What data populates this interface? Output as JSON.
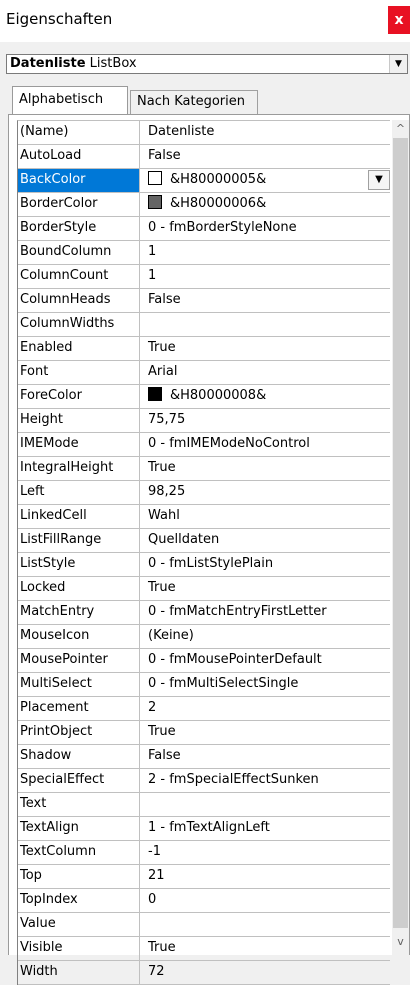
{
  "window": {
    "title": "Eigenschaften",
    "close_label": "x"
  },
  "object_selector": {
    "name": "Datenliste",
    "type": "ListBox",
    "arrow": "▼"
  },
  "tabs": [
    {
      "label": "Alphabetisch",
      "active": true
    },
    {
      "label": "Nach Kategorien",
      "active": false
    }
  ],
  "properties": [
    {
      "name": "(Name)",
      "value": "Datenliste"
    },
    {
      "name": "AutoLoad",
      "value": "False"
    },
    {
      "name": "BackColor",
      "value": "&H80000005&",
      "swatch": "#ffffff",
      "selected": true
    },
    {
      "name": "BorderColor",
      "value": "&H80000006&",
      "swatch": "#646464"
    },
    {
      "name": "BorderStyle",
      "value": "0 - fmBorderStyleNone"
    },
    {
      "name": "BoundColumn",
      "value": "1"
    },
    {
      "name": "ColumnCount",
      "value": "1"
    },
    {
      "name": "ColumnHeads",
      "value": "False"
    },
    {
      "name": "ColumnWidths",
      "value": ""
    },
    {
      "name": "Enabled",
      "value": "True"
    },
    {
      "name": "Font",
      "value": "Arial"
    },
    {
      "name": "ForeColor",
      "value": "&H80000008&",
      "swatch": "#000000"
    },
    {
      "name": "Height",
      "value": "75,75"
    },
    {
      "name": "IMEMode",
      "value": "0 - fmIMEModeNoControl"
    },
    {
      "name": "IntegralHeight",
      "value": "True"
    },
    {
      "name": "Left",
      "value": "98,25"
    },
    {
      "name": "LinkedCell",
      "value": "Wahl"
    },
    {
      "name": "ListFillRange",
      "value": "Quelldaten"
    },
    {
      "name": "ListStyle",
      "value": "0 - fmListStylePlain"
    },
    {
      "name": "Locked",
      "value": "True"
    },
    {
      "name": "MatchEntry",
      "value": "0 - fmMatchEntryFirstLetter"
    },
    {
      "name": "MouseIcon",
      "value": "(Keine)"
    },
    {
      "name": "MousePointer",
      "value": "0 - fmMousePointerDefault"
    },
    {
      "name": "MultiSelect",
      "value": "0 - fmMultiSelectSingle"
    },
    {
      "name": "Placement",
      "value": "2"
    },
    {
      "name": "PrintObject",
      "value": "True"
    },
    {
      "name": "Shadow",
      "value": "False"
    },
    {
      "name": "SpecialEffect",
      "value": "2 - fmSpecialEffectSunken"
    },
    {
      "name": "Text",
      "value": ""
    },
    {
      "name": "TextAlign",
      "value": "1 - fmTextAlignLeft"
    },
    {
      "name": "TextColumn",
      "value": "-1"
    },
    {
      "name": "Top",
      "value": "21"
    },
    {
      "name": "TopIndex",
      "value": "0"
    },
    {
      "name": "Value",
      "value": ""
    },
    {
      "name": "Visible",
      "value": "True"
    },
    {
      "name": "Width",
      "value": "72"
    }
  ],
  "colors": {
    "selection": "#0078d7",
    "close_button": "#e81123"
  }
}
